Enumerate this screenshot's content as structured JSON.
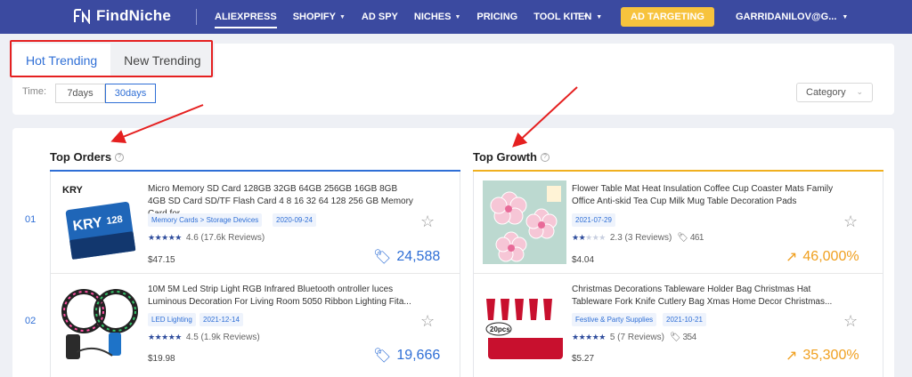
{
  "brand": {
    "name": "FindNiche"
  },
  "nav": {
    "items": [
      {
        "label": "ALIEXPRESS",
        "caret": false,
        "active": true
      },
      {
        "label": "SHOPIFY",
        "caret": true,
        "active": false
      },
      {
        "label": "AD SPY",
        "caret": false,
        "active": false
      },
      {
        "label": "NICHES",
        "caret": true,
        "active": false
      },
      {
        "label": "PRICING",
        "caret": false,
        "active": false
      },
      {
        "label": "TOOL KIT",
        "caret": true,
        "active": false
      }
    ],
    "lang": "EN",
    "ad_button": "AD TARGETING",
    "user": "GARRIDANILOV@G...",
    "accent": "#3b4aa0",
    "ad_color": "#f7c33d"
  },
  "tabs": {
    "hot": "Hot Trending",
    "new": "New Trending"
  },
  "filters": {
    "time_label": "Time:",
    "option_7": "7days",
    "option_30": "30days",
    "selected": "30days",
    "category_placeholder": "Category"
  },
  "top_orders": {
    "title": "Top Orders",
    "line_color": "#2f6fd6",
    "items": [
      {
        "rank": "01",
        "title": "Micro Memory SD Card 128GB 32GB 64GB 256GB 16GB 8GB 4GB SD Card SD/TF Flash Card 4 8 16 32 64 128 256 GB Memory Card for...",
        "category": "Memory Cards > Storage Devices",
        "date": "2020-09-24",
        "rating_text": "4.6 (17.6k Reviews)",
        "rating": 4.6,
        "price": "$47.15",
        "orders": "24,588"
      },
      {
        "rank": "02",
        "title": "10M 5M Led Strip Light RGB Infrared Bluetooth ontroller luces Luminous Decoration For Living Room 5050 Ribbon Lighting Fita...",
        "category": "LED Lighting",
        "date": "2021-12-14",
        "rating_text": "4.5 (1.9k Reviews)",
        "rating": 4.5,
        "price": "$19.98",
        "orders": "19,666"
      }
    ]
  },
  "top_growth": {
    "title": "Top Growth",
    "line_color": "#f0b020",
    "items": [
      {
        "title": "Flower Table Mat Heat Insulation Coffee Cup Coaster Mats Family Office Anti-skid Tea Cup Milk Mug Table Decoration Pads",
        "date": "2021-07-29",
        "rating_text": "2.3 (3 Reviews)",
        "rating": 2.3,
        "sold": "461",
        "price": "$4.04",
        "growth": "46,000%"
      },
      {
        "title": "Christmas Decorations Tableware Holder Bag Christmas Hat Tableware Fork Knife Cutlery Bag Xmas Home Decor Christmas...",
        "category": "Festive & Party Supplies",
        "date": "2021-10-21",
        "rating_text": "5 (7 Reviews)",
        "rating": 5,
        "sold": "354",
        "price": "$5.27",
        "growth": "35,300%"
      }
    ]
  }
}
